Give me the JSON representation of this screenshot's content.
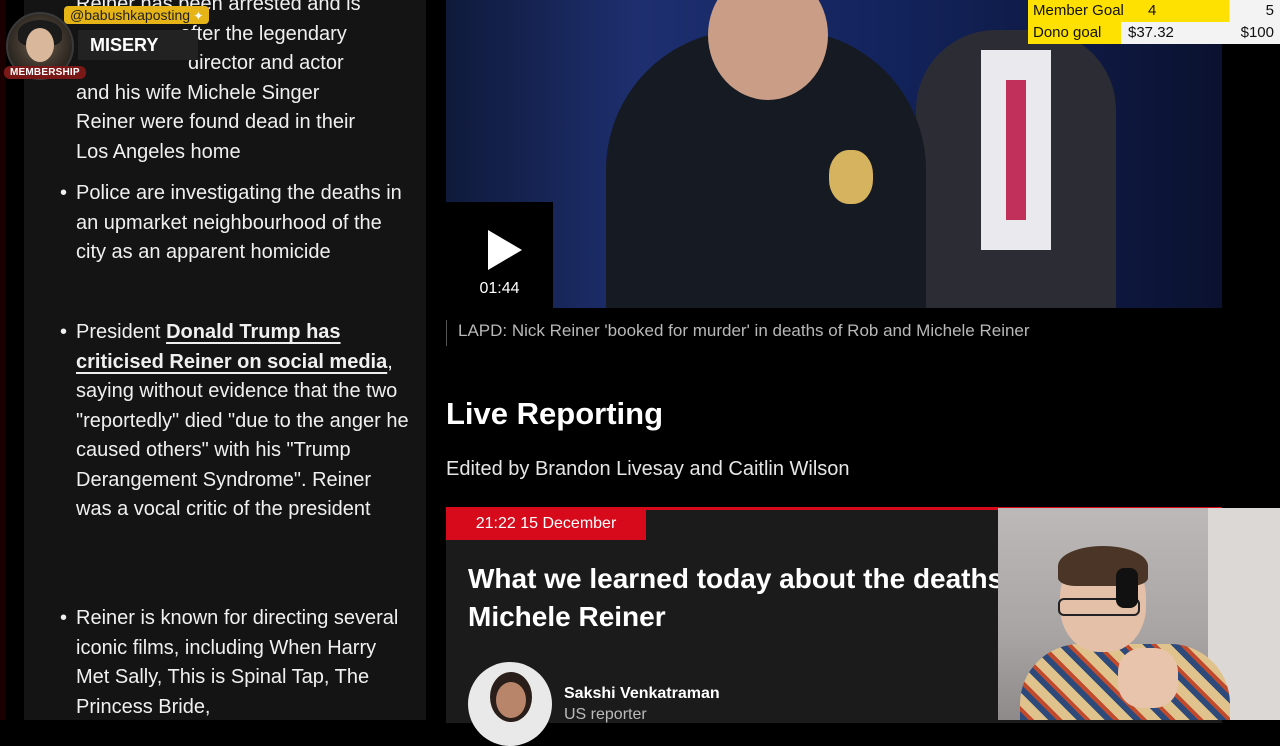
{
  "streamer": {
    "handle": "@babushkaposting",
    "status": "MISERY",
    "membership_label": "MEMBERSHIP"
  },
  "left_bullets": {
    "first_text_lines": [
      "Reiner has been arrested and is",
      "after the legendary",
      "director and actor",
      "and his wife Michele Singer",
      "Reiner were found dead in their",
      "Los Angeles home"
    ],
    "police": "Police are investigating the deaths in an upmarket neighbourhood of the city as an apparent homicide",
    "trump_prefix": "President ",
    "trump_link": "Donald Trump has criticised Reiner on social media",
    "trump_suffix": ", saying without evidence that the two \"reportedly\" died \"due to the anger he caused others\" with his \"Trump Derangement Syndrome\". Reiner was a vocal critic of the president",
    "films": "Reiner is known for directing several iconic films, including When Harry Met Sally, This is Spinal Tap, The Princess Bride,"
  },
  "video": {
    "duration": "01:44",
    "caption": "LAPD: Nick Reiner 'booked for murder' in deaths of Rob and Michele Reiner"
  },
  "live": {
    "title": "Live Reporting",
    "editors": "Edited by Brandon Livesay and Caitlin Wilson"
  },
  "post": {
    "timestamp": "21:22 15 December",
    "title": "What we learned today about the deaths of Rob and Michele Reiner",
    "author_name": "Sakshi Venkatraman",
    "author_role": "US reporter"
  },
  "goals": {
    "member_label": "Member Goal",
    "member_current": "4",
    "member_max": "5",
    "member_progress": 0.8,
    "dono_label": "Dono goal",
    "dono_current": "$37.32",
    "dono_max": "$100",
    "dono_progress": 0.37
  },
  "colors": {
    "accent_red": "#d60a1a",
    "goal_yellow": "#ffe100",
    "handle_bg": "#e6b417"
  }
}
